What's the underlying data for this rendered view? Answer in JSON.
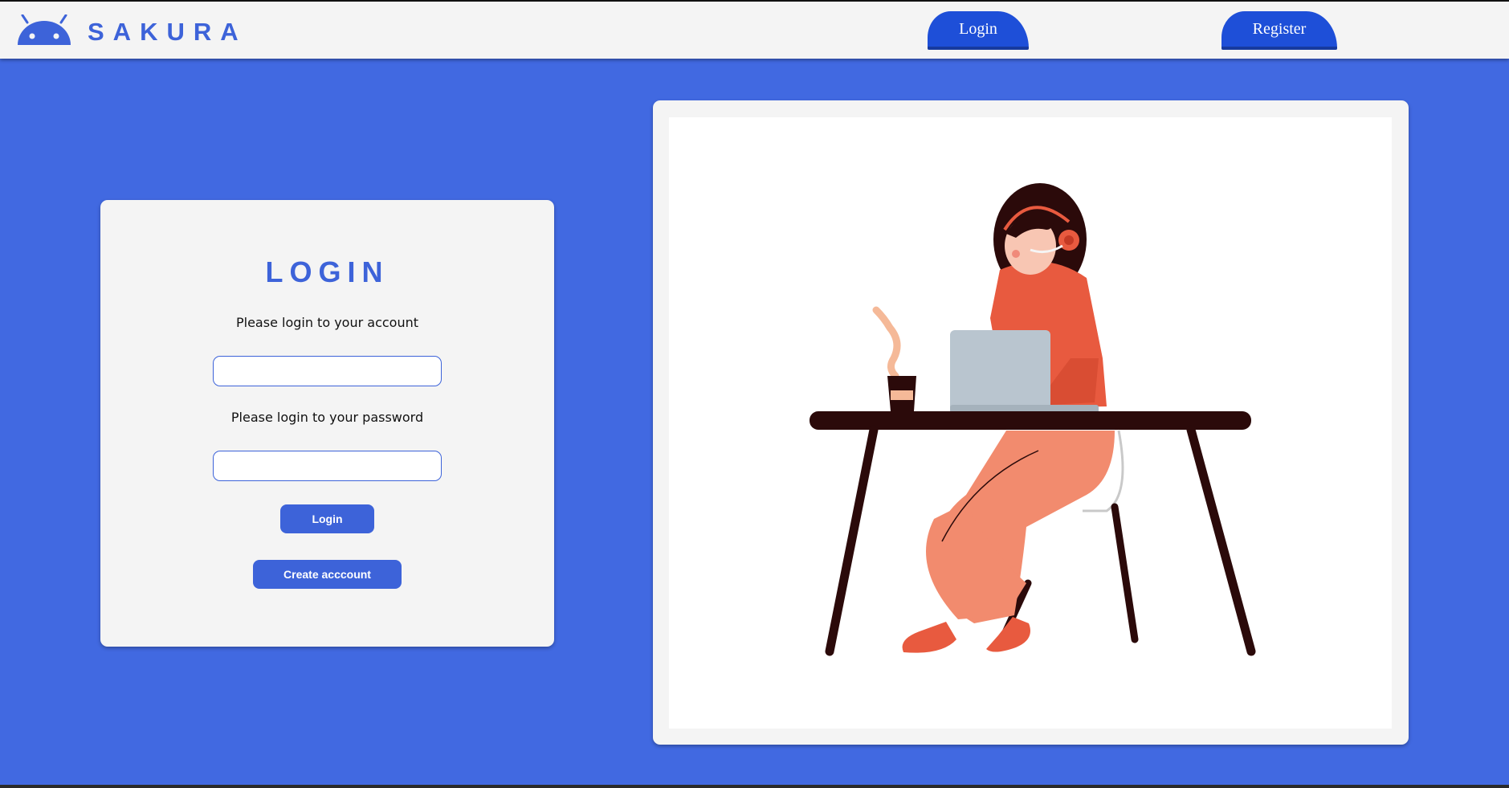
{
  "header": {
    "brand": "SAKURA",
    "logo_icon": "android-head-icon",
    "nav": {
      "login_label": "Login",
      "register_label": "Register"
    }
  },
  "login": {
    "title": "LOGIN",
    "account_prompt": "Please login to your account",
    "password_prompt": "Please login to your password",
    "username_value": "",
    "password_value": "",
    "login_button": "Login",
    "create_button": "Create acccount"
  },
  "illustration": {
    "icon": "woman-with-headset-at-laptop-illustration"
  },
  "colors": {
    "background": "#4169e1",
    "accent": "#3d63d9",
    "nav_button": "#1e4fd8",
    "card": "#f4f4f4"
  }
}
